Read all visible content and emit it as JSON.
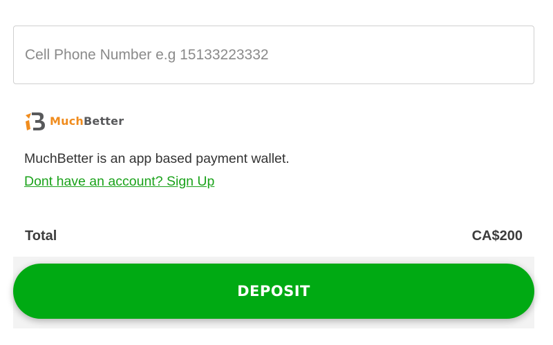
{
  "phone_input": {
    "placeholder": "Cell Phone Number e.g 15133223332",
    "value": ""
  },
  "brand": {
    "logo_icon": "muchbetter-logo-icon",
    "name_part1": "Much",
    "name_part2": "Better",
    "color_primary": "#f08c1e",
    "color_secondary": "#58595b"
  },
  "description": "MuchBetter is an app based payment wallet.",
  "signup_link": "Dont have an account? Sign Up",
  "total": {
    "label": "Total",
    "value": "CA$200"
  },
  "deposit_button": {
    "label": "DEPOSIT",
    "color": "#00aa13"
  }
}
